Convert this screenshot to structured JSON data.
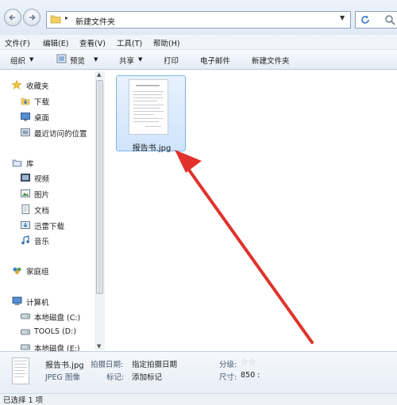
{
  "address": {
    "path": "新建文件夹"
  },
  "menu": [
    "文件(F)",
    "编辑(E)",
    "查看(V)",
    "工具(T)",
    "帮助(H)"
  ],
  "toolbar": {
    "organize": "组织",
    "preview": "预览",
    "share": "共享",
    "print": "打印",
    "email": "电子邮件",
    "new_folder": "新建文件夹"
  },
  "sidebar": {
    "favorites": {
      "label": "收藏夹",
      "items": [
        "下载",
        "桌面",
        "最近访问的位置"
      ]
    },
    "libraries": {
      "label": "库",
      "items": [
        "视频",
        "图片",
        "文档",
        "迅雷下载",
        "音乐"
      ]
    },
    "homegroup": {
      "label": "家庭组"
    },
    "computer": {
      "label": "计算机",
      "items": [
        "本地磁盘 (C:)",
        "TOOLS (D:)",
        "本地磁盘 (E:)"
      ]
    }
  },
  "file": {
    "name": "报告书.jpg"
  },
  "details": {
    "name": "报告书.jpg",
    "type": "JPEG 图像",
    "date_label": "拍摄日期:",
    "date_value": "指定拍摄日期",
    "tags_label": "标记:",
    "tags_value": "添加标记",
    "rating_label": "分级:",
    "size_label": "尺寸:",
    "size_value": "850 :"
  },
  "status": "已选择 1 项",
  "colors": {
    "arrow": "#e0322c",
    "selection": "#cfe4fb",
    "accent": "#7eb4ea"
  }
}
